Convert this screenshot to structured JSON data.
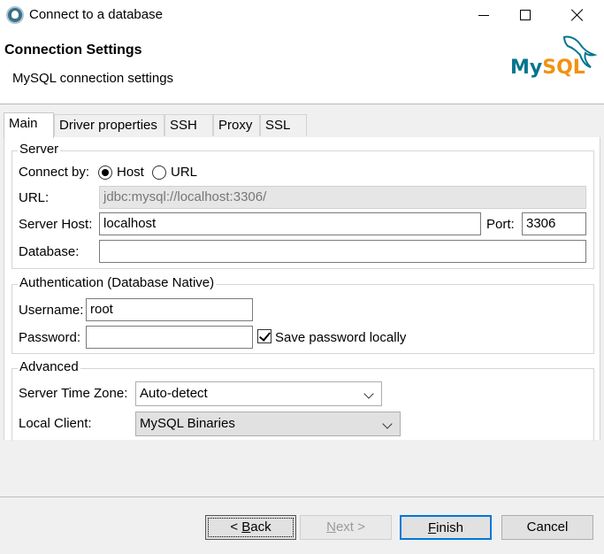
{
  "window": {
    "title": "Connect to a database"
  },
  "header": {
    "title": "Connection Settings",
    "subtitle": "MySQL connection settings",
    "logo_my": "My",
    "logo_sql": "SQL",
    "logo_colors": {
      "my": "#00758f",
      "sql": "#f29111"
    }
  },
  "tabs": [
    {
      "label": "Main",
      "active": true
    },
    {
      "label": "Driver properties",
      "active": false
    },
    {
      "label": "SSH",
      "active": false
    },
    {
      "label": "Proxy",
      "active": false
    },
    {
      "label": "SSL",
      "active": false
    }
  ],
  "server": {
    "group_label": "Server",
    "connect_by_label": "Connect by:",
    "host_option": "Host",
    "url_option": "URL",
    "selected": "Host",
    "url_label": "URL:",
    "url_value": "jdbc:mysql://localhost:3306/",
    "host_label": "Server Host:",
    "host_value": "localhost",
    "port_label": "Port:",
    "port_value": "3306",
    "database_label": "Database:",
    "database_value": ""
  },
  "auth": {
    "group_label": "Authentication (Database Native)",
    "username_label": "Username:",
    "username_value": "root",
    "password_label": "Password:",
    "password_value": "",
    "save_password_label": "Save password locally",
    "save_password_checked": true
  },
  "advanced": {
    "group_label": "Advanced",
    "timezone_label": "Server Time Zone:",
    "timezone_value": "Auto-detect",
    "local_client_label": "Local Client:",
    "local_client_value": "MySQL Binaries"
  },
  "footer": {
    "back_prefix": "< ",
    "back_mnemonic": "B",
    "back_rest": "ack",
    "next_prefix": "",
    "next_mnemonic": "N",
    "next_rest": "ext >",
    "finish_mnemonic": "F",
    "finish_rest": "inish",
    "cancel_label": "Cancel"
  }
}
